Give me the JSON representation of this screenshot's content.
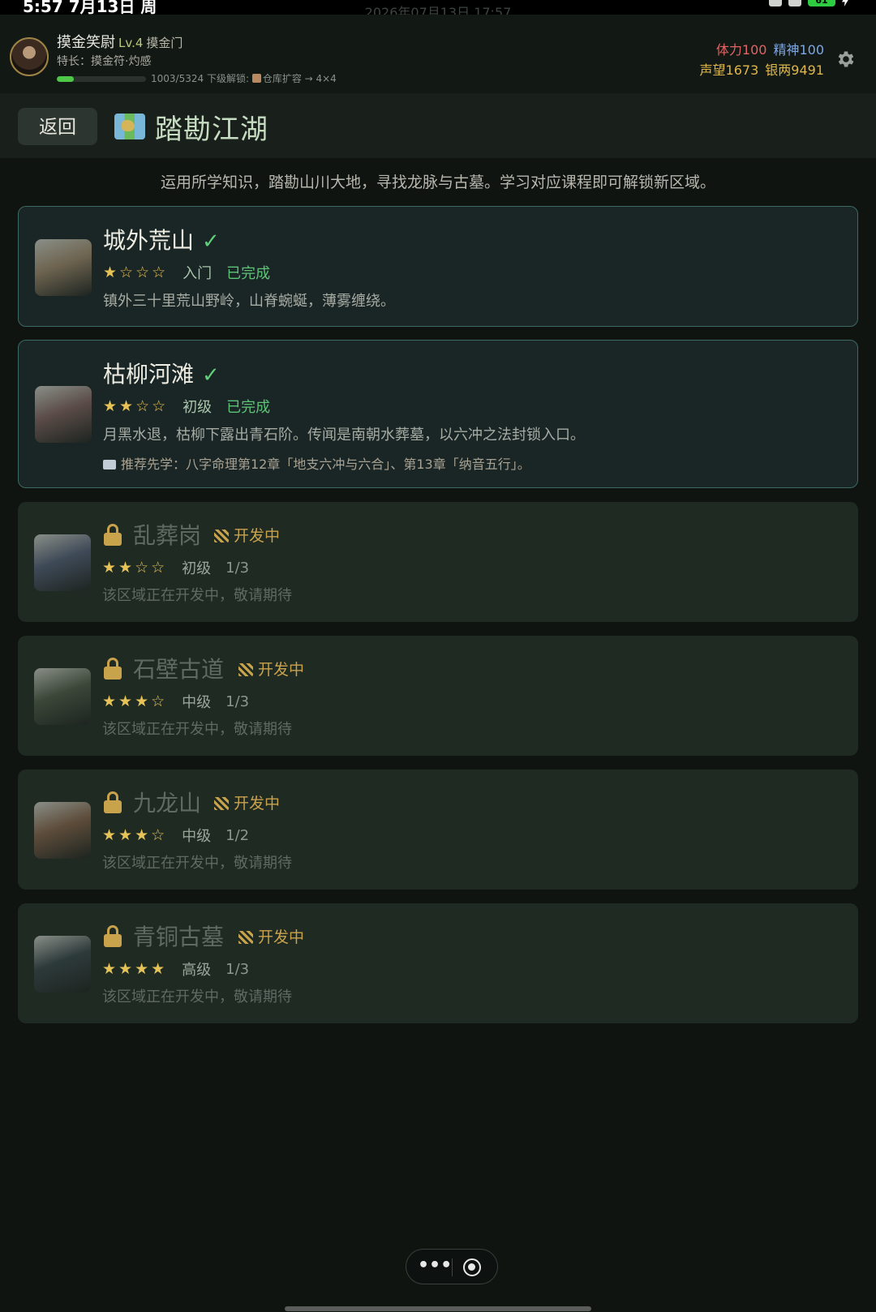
{
  "status_bar": {
    "time": "5:57  7月13日 周",
    "battery": "61",
    "system_time": "2026年07月13日 17:57"
  },
  "player": {
    "name": "摸金笑尉",
    "level": "Lv.4",
    "sect": "摸金门",
    "skill": "特长：摸金符·灼感",
    "xp_text": "1003/5324",
    "unlock_text": "下级解锁: ",
    "unlock_target": "仓库扩容 → 4×4",
    "xp_fraction": 0.188
  },
  "stats": {
    "stamina": "体力100",
    "spirit": "精神100",
    "reputation": "声望1673",
    "silver": "银两9491"
  },
  "header": {
    "back_label": "返回",
    "title": "踏勘江湖"
  },
  "intro": "运用所学知识，踏勘山川大地，寻找龙脉与古墓。学习对应课程即可解锁新区域。",
  "regions": [
    {
      "name": "城外荒山",
      "stars": "★☆☆☆",
      "level": "入门",
      "status": "已完成",
      "desc": "镇外三十里荒山野岭，山脊蜿蜒，薄雾缠绕。",
      "thumb_color": "#6e6450"
    },
    {
      "name": "枯柳河滩",
      "stars": "★★☆☆",
      "level": "初级",
      "status": "已完成",
      "desc": "月黑水退，枯柳下露出青石阶。传闻是南朝水葬墓，以六冲之法封锁入口。",
      "hint": "推荐先学：八字命理第12章「地支六冲与六合」、第13章「纳音五行」。",
      "thumb_color": "#5b4c48"
    },
    {
      "name": "乱葬岗",
      "stars": "★★☆☆",
      "level": "初级",
      "progress": "1/3",
      "dev": "开发中",
      "desc": "该区域正在开发中，敬请期待",
      "thumb_color": "#3f4a58"
    },
    {
      "name": "石壁古道",
      "stars": "★★★☆",
      "level": "中级",
      "progress": "1/3",
      "dev": "开发中",
      "desc": "该区域正在开发中，敬请期待",
      "thumb_color": "#3b4738"
    },
    {
      "name": "九龙山",
      "stars": "★★★☆",
      "level": "中级",
      "progress": "1/2",
      "dev": "开发中",
      "desc": "该区域正在开发中，敬请期待",
      "thumb_color": "#5d4c3a"
    },
    {
      "name": "青铜古墓",
      "stars": "★★★★",
      "level": "高级",
      "progress": "1/3",
      "dev": "开发中",
      "desc": "该区域正在开发中，敬请期待",
      "thumb_color": "#2d3a3a"
    }
  ],
  "capsule": {
    "more": "•••"
  }
}
